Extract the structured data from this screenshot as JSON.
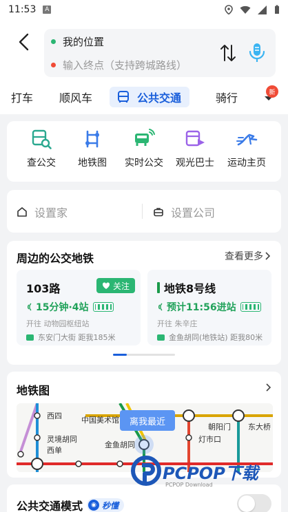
{
  "status_bar": {
    "time": "11:53",
    "app_icon_letter": "A"
  },
  "route": {
    "from": "我的位置",
    "to_placeholder": "输入终点（支持跨城路线）",
    "from_dot_color": "#2bb673",
    "to_dot_color": "#f04b36"
  },
  "tabs": [
    {
      "label": "打车"
    },
    {
      "label": "顺风车"
    },
    {
      "label": "公共交通",
      "active": true
    },
    {
      "label": "骑行"
    }
  ],
  "more_badge": "新",
  "quick_actions": [
    {
      "label": "查公交",
      "icon": "bus-search-icon"
    },
    {
      "label": "地铁图",
      "icon": "metro-map-icon"
    },
    {
      "label": "实时公交",
      "icon": "realtime-bus-icon"
    },
    {
      "label": "观光巴士",
      "icon": "sightseeing-bus-icon"
    },
    {
      "label": "运动主页",
      "icon": "sport-icon"
    }
  ],
  "places": {
    "home": "设置家",
    "company": "设置公司"
  },
  "nearby": {
    "title": "周边的公交地铁",
    "see_more": "查看更多",
    "lines": [
      {
        "name": "103路",
        "follow": "关注",
        "eta": "15分钟·4站",
        "direction": "开往 动物园枢纽站",
        "stop": "东安门大街 距我185米"
      },
      {
        "name": "地铁8号线",
        "eta": "预计11:56进站",
        "direction": "开往 朱辛庄",
        "stop": "金鱼胡同(地铁站) 距我80米"
      }
    ]
  },
  "metro_map": {
    "title": "地铁图",
    "tooltip": "离我最近",
    "stations": [
      "西四",
      "中国美术馆",
      "灵境胡同",
      "西单",
      "金鱼胡同",
      "朝阳门",
      "灯市口",
      "东大桥"
    ]
  },
  "transit_mode": {
    "title": "公共交通模式",
    "badge": "秒懂",
    "badge_icon_text": "◉"
  },
  "watermark": {
    "text": "PCPOP下载",
    "sub": "PCPOP Download"
  },
  "colors": {
    "accent": "#1a5fdb",
    "green": "#2bb673",
    "background": "#f2f3f5"
  }
}
